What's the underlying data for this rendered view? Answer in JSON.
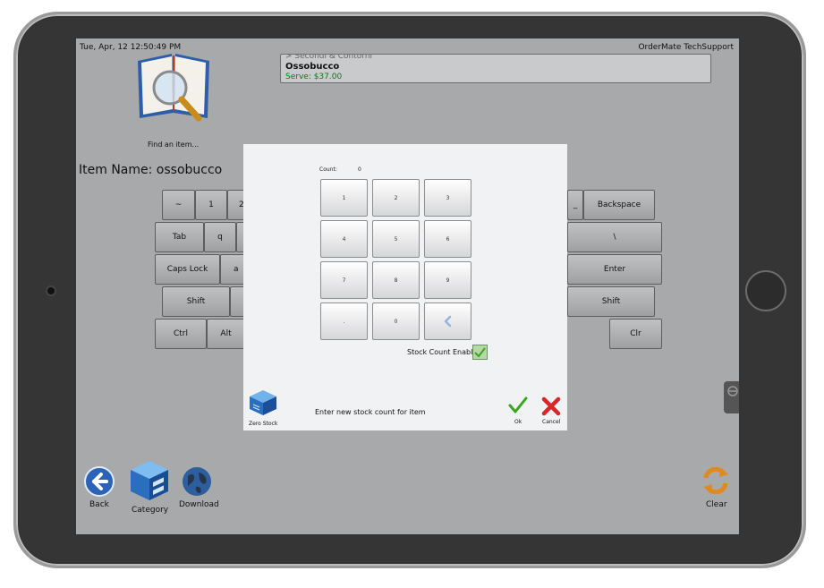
{
  "status_bar": {
    "datetime": "Tue, Apr, 12 12:50:49 PM",
    "app_title": "OrderMate TechSupport"
  },
  "find": {
    "label": "Find an item...",
    "icon": "book-magnifier-icon"
  },
  "result": {
    "category": "> Secondi & Contorni",
    "name": "Ossobucco",
    "price": "Serve: $37.00"
  },
  "item_name": {
    "text": "Item Name: ossobucco"
  },
  "keyboard": {
    "row1": [
      "~",
      "1",
      "2"
    ],
    "row1_right": [
      "_",
      "Backspace"
    ],
    "row2": [
      "Tab",
      "q"
    ],
    "row2_right": [
      "\\"
    ],
    "row3": [
      "Caps Lock",
      "a"
    ],
    "row3_right": [
      "Enter"
    ],
    "row4": [
      "Shift"
    ],
    "row4_right": [
      "Shift"
    ],
    "row5": [
      "Ctrl",
      "Alt"
    ],
    "row5_right": [
      "Clr"
    ]
  },
  "modal": {
    "count_label": "Count:",
    "count_value": "0",
    "keypad": [
      "1",
      "2",
      "3",
      "4",
      "5",
      "6",
      "7",
      "8",
      "9",
      ".",
      "0"
    ],
    "backspace_icon": "chevron-left-icon",
    "stock_count_enabled_label": "Stock Count Enabled",
    "zero_stock_label": "Zero Stock",
    "prompt": "Enter new stock count for item",
    "ok_label": "Ok",
    "cancel_label": "Cancel"
  },
  "bottom_bar": {
    "back": "Back",
    "category": "Category",
    "download": "Download",
    "clear": "Clear"
  },
  "colors": {
    "screen_bg": "#a8a9aa",
    "price_green": "#0a7a14",
    "ok_green": "#3aa51d",
    "cancel_red": "#d8262a",
    "checkbox_green": "#b4d8a6"
  }
}
